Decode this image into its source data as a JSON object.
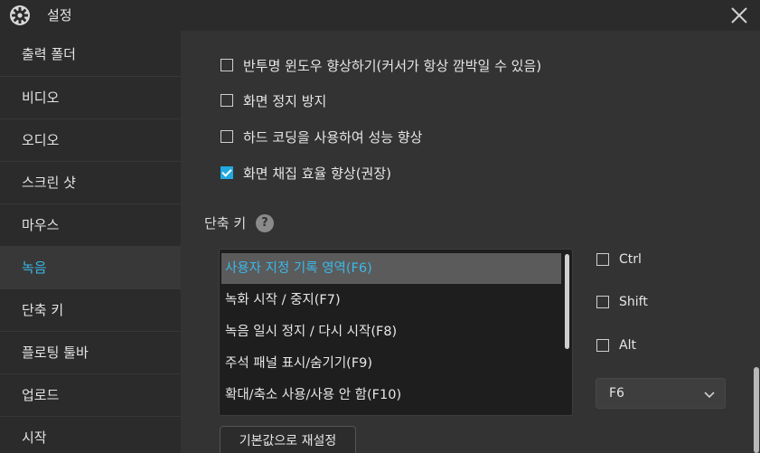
{
  "window": {
    "title": "설정",
    "icons": {
      "app": "gear-icon",
      "close": "close-icon"
    }
  },
  "sidebar": {
    "items": [
      {
        "label": "출력 폴더",
        "active": false
      },
      {
        "label": "비디오",
        "active": false
      },
      {
        "label": "오디오",
        "active": false
      },
      {
        "label": "스크린 샷",
        "active": false
      },
      {
        "label": "마우스",
        "active": false
      },
      {
        "label": "녹음",
        "active": true
      },
      {
        "label": "단축 키",
        "active": false
      },
      {
        "label": "플로팅 툴바",
        "active": false
      },
      {
        "label": "업로드",
        "active": false
      },
      {
        "label": "시작",
        "active": false
      }
    ]
  },
  "recording": {
    "options": [
      {
        "label": "반투명 윈도우 향상하기(커서가 항상 깜박일 수 있음)",
        "checked": false
      },
      {
        "label": "화면 정지 방지",
        "checked": false
      },
      {
        "label": "하드 코딩을 사용하여 성능 향상",
        "checked": false
      },
      {
        "label": "화면 채집 효율 향상(권장)",
        "checked": true
      }
    ]
  },
  "hotkeys": {
    "title": "단축 키",
    "help_icon": "help-icon",
    "help_glyph": "?",
    "items": [
      {
        "label": "사용자 지정 기록 영역(F6)",
        "selected": true
      },
      {
        "label": "녹화 시작 / 중지(F7)",
        "selected": false
      },
      {
        "label": "녹음 일시 정지 / 다시 시작(F8)",
        "selected": false
      },
      {
        "label": "주석 패널 표시/숨기기(F9)",
        "selected": false
      },
      {
        "label": "확대/축소 사용/사용 안 함(F10)",
        "selected": false
      }
    ],
    "modifiers": [
      {
        "label": "Ctrl",
        "checked": false
      },
      {
        "label": "Shift",
        "checked": false
      },
      {
        "label": "Alt",
        "checked": false
      }
    ],
    "key": {
      "value": "F6",
      "icon": "chevron-down-icon"
    },
    "reset_label": "기본값으로 재설정"
  },
  "colors": {
    "accent": "#3bb8e8",
    "checkbox_checked": "#21a9e1",
    "background": "#333333",
    "sidebar_bg": "#2b2b2b"
  }
}
